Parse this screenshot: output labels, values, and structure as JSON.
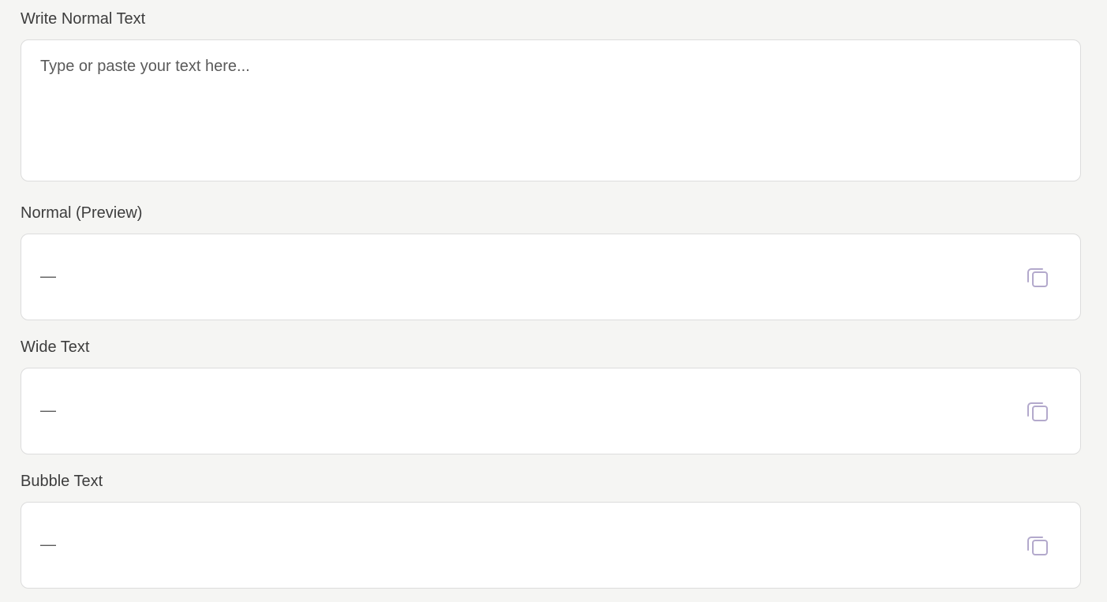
{
  "input_section": {
    "label": "Write Normal Text",
    "placeholder": "Type or paste your text here..."
  },
  "outputs": [
    {
      "label": "Normal (Preview)",
      "value": "—"
    },
    {
      "label": "Wide Text",
      "value": "—"
    },
    {
      "label": "Bubble Text",
      "value": "—"
    }
  ],
  "icons": {
    "copy": "copy-icon"
  },
  "colors": {
    "background": "#f5f5f3",
    "box": "#ffffff",
    "border": "#dcdcdc",
    "copy_icon": "#b3a9cc"
  }
}
